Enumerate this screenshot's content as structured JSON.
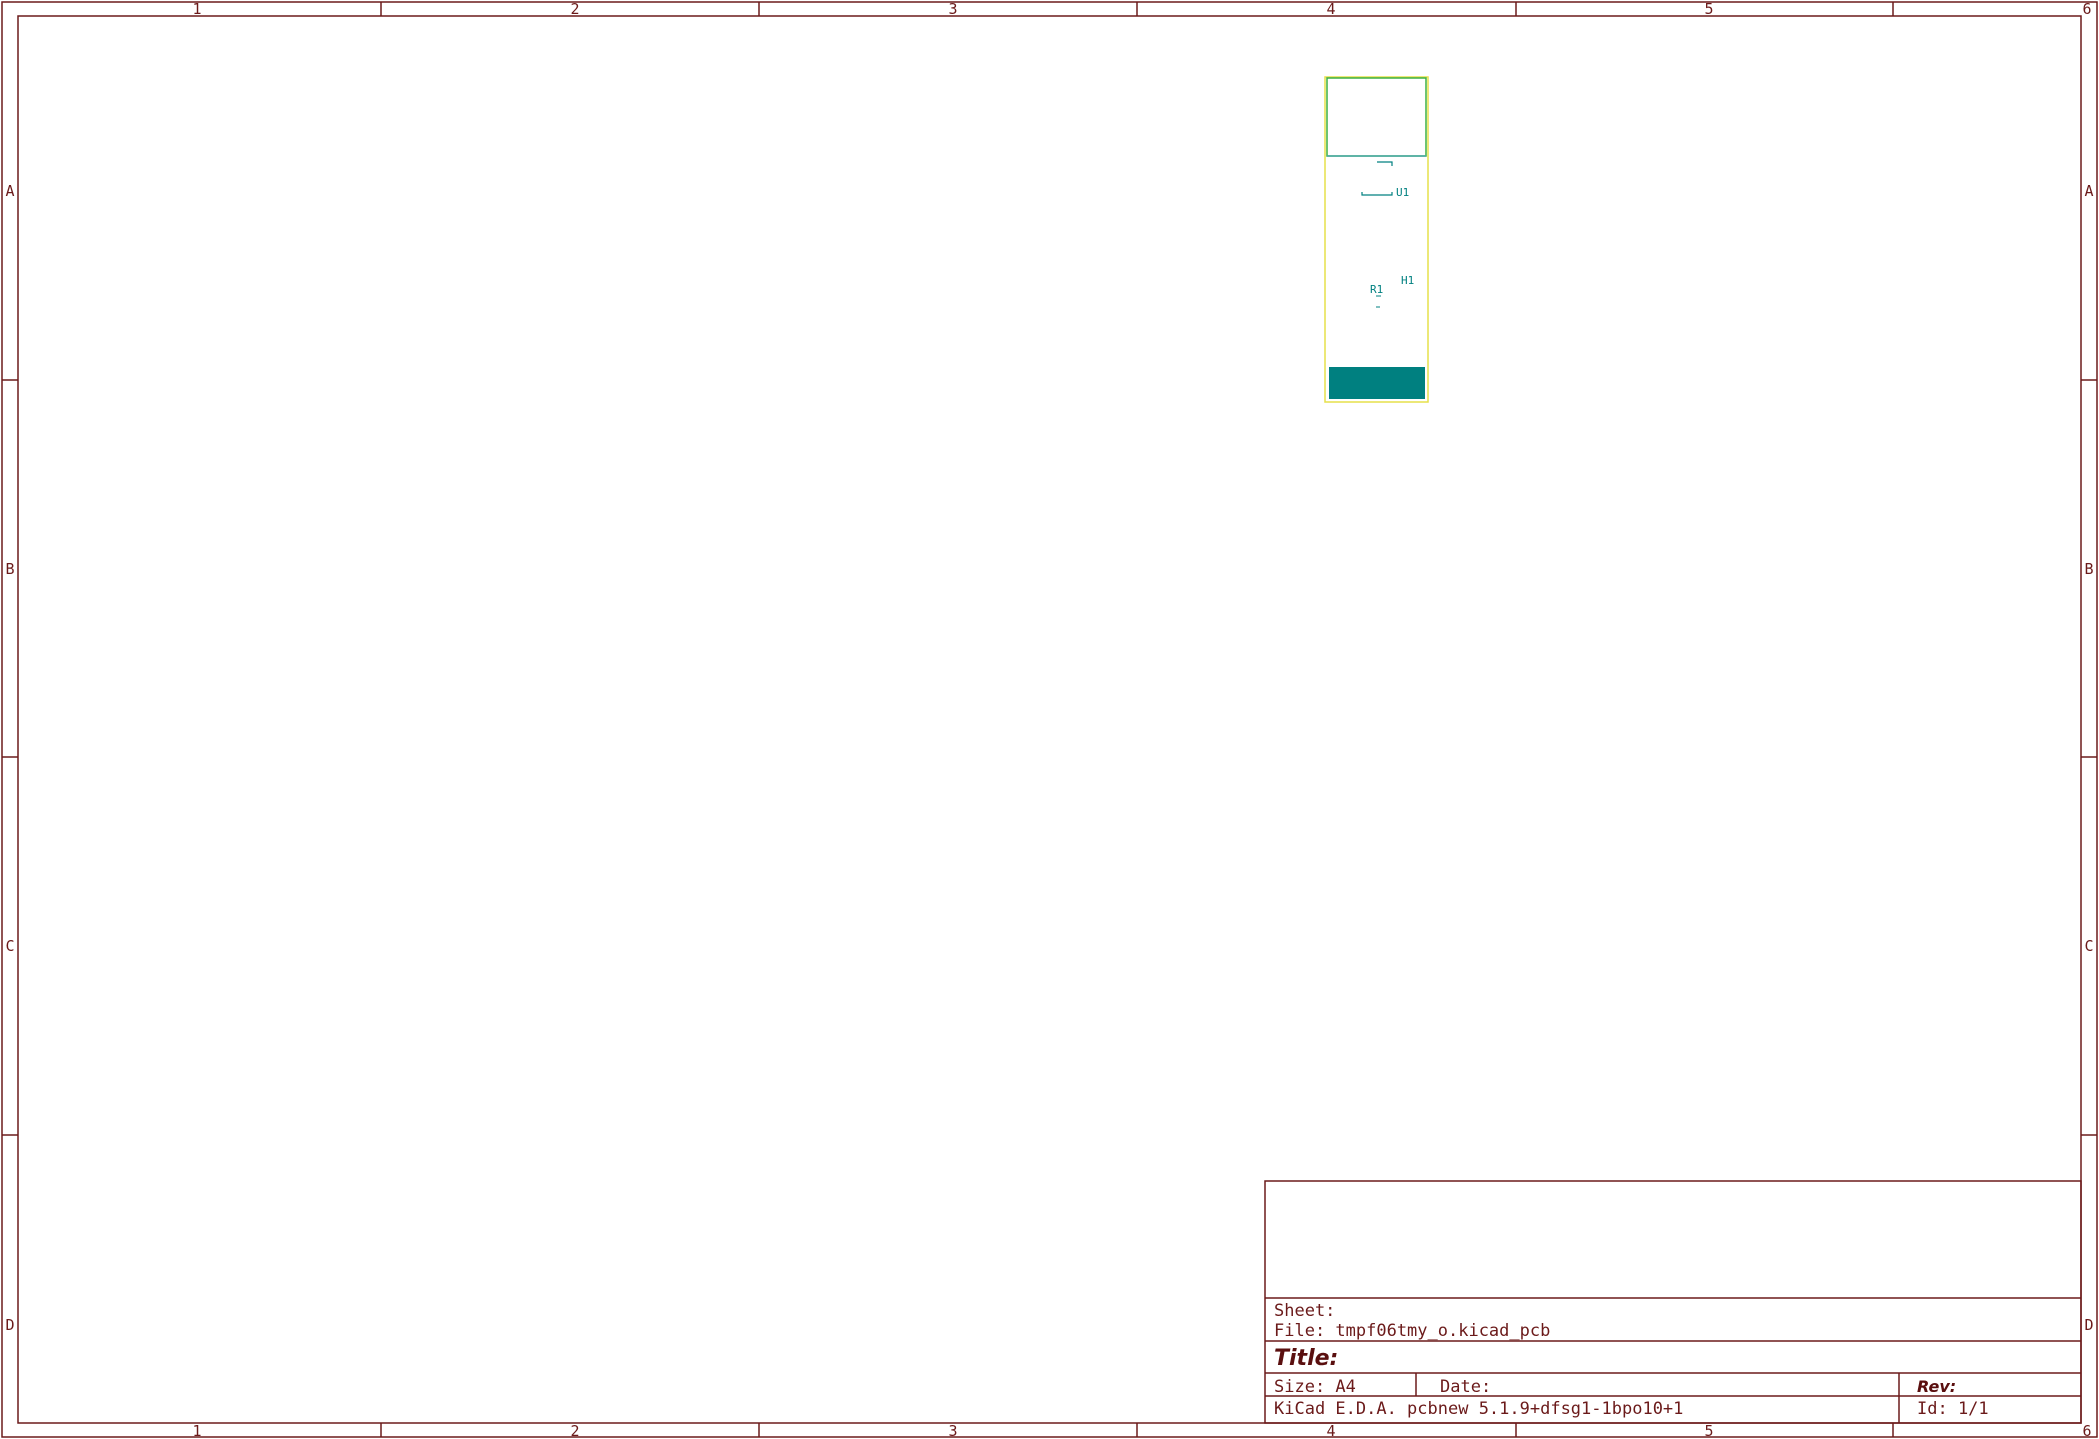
{
  "border": {
    "column_labels": [
      "1",
      "2",
      "3",
      "4",
      "5",
      "6"
    ],
    "row_labels": [
      "A",
      "B",
      "C",
      "D"
    ]
  },
  "board": {
    "references": {
      "u1": "U1",
      "h1": "H1",
      "r1": "R1"
    },
    "colors": {
      "edge_cuts": "#e6e04a",
      "courtyard": "#3cb043",
      "silkscreen": "#008080",
      "copper_fill": "#008080"
    }
  },
  "title_block": {
    "sheet_label": "Sheet:",
    "file_label": "File: tmpf06tmy_o.kicad_pcb",
    "title_label": "Title:",
    "size_label": "Size: A4",
    "date_label": "Date:",
    "rev_label": "Rev:",
    "app_label": "KiCad E.D.A.  pcbnew 5.1.9+dfsg1-1bpo10+1",
    "id_label": "Id: 1/1"
  }
}
